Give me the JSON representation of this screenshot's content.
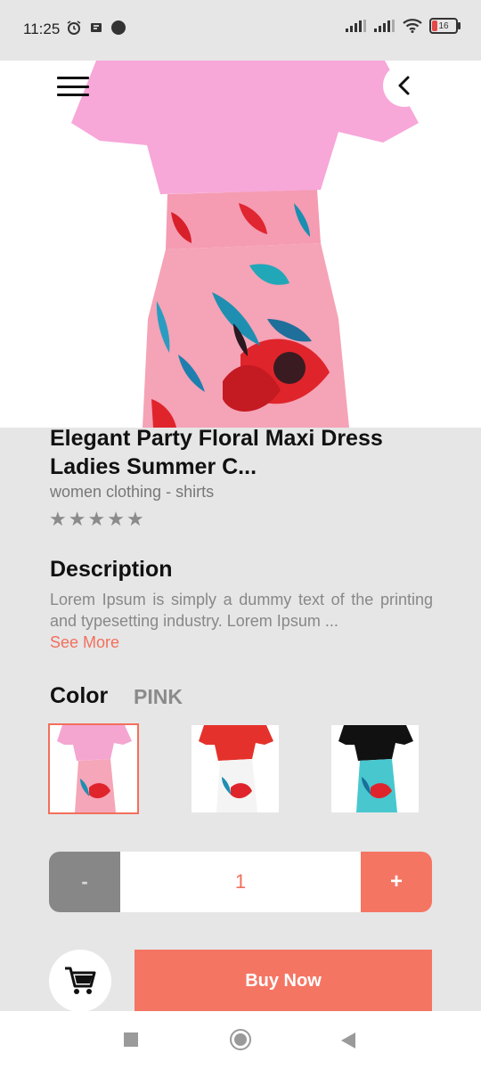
{
  "status": {
    "time": "11:25",
    "battery": "16"
  },
  "product": {
    "title": "Elegant Party Floral Maxi Dress Ladies Summer C...",
    "category": "women clothing - shirts",
    "rating": 0,
    "rating_max": 5
  },
  "description": {
    "heading": "Description",
    "text": "Lorem Ipsum is simply a dummy text of the printing and typesetting industry. Lorem Ipsum ...",
    "see_more": "See More"
  },
  "color": {
    "label": "Color",
    "selected": "PINK",
    "options": [
      {
        "top": "#f4a6d1",
        "skirt": "#f5a6b8",
        "selected": true
      },
      {
        "top": "#e5312b",
        "skirt": "#ffffff",
        "selected": false
      },
      {
        "top": "#111111",
        "skirt": "#48c7cf",
        "selected": false
      }
    ]
  },
  "quantity": {
    "minus": "-",
    "value": "1",
    "plus": "+"
  },
  "actions": {
    "buy_now": "Buy Now"
  },
  "colors": {
    "accent": "#f57563",
    "background": "#e6e6e7"
  }
}
